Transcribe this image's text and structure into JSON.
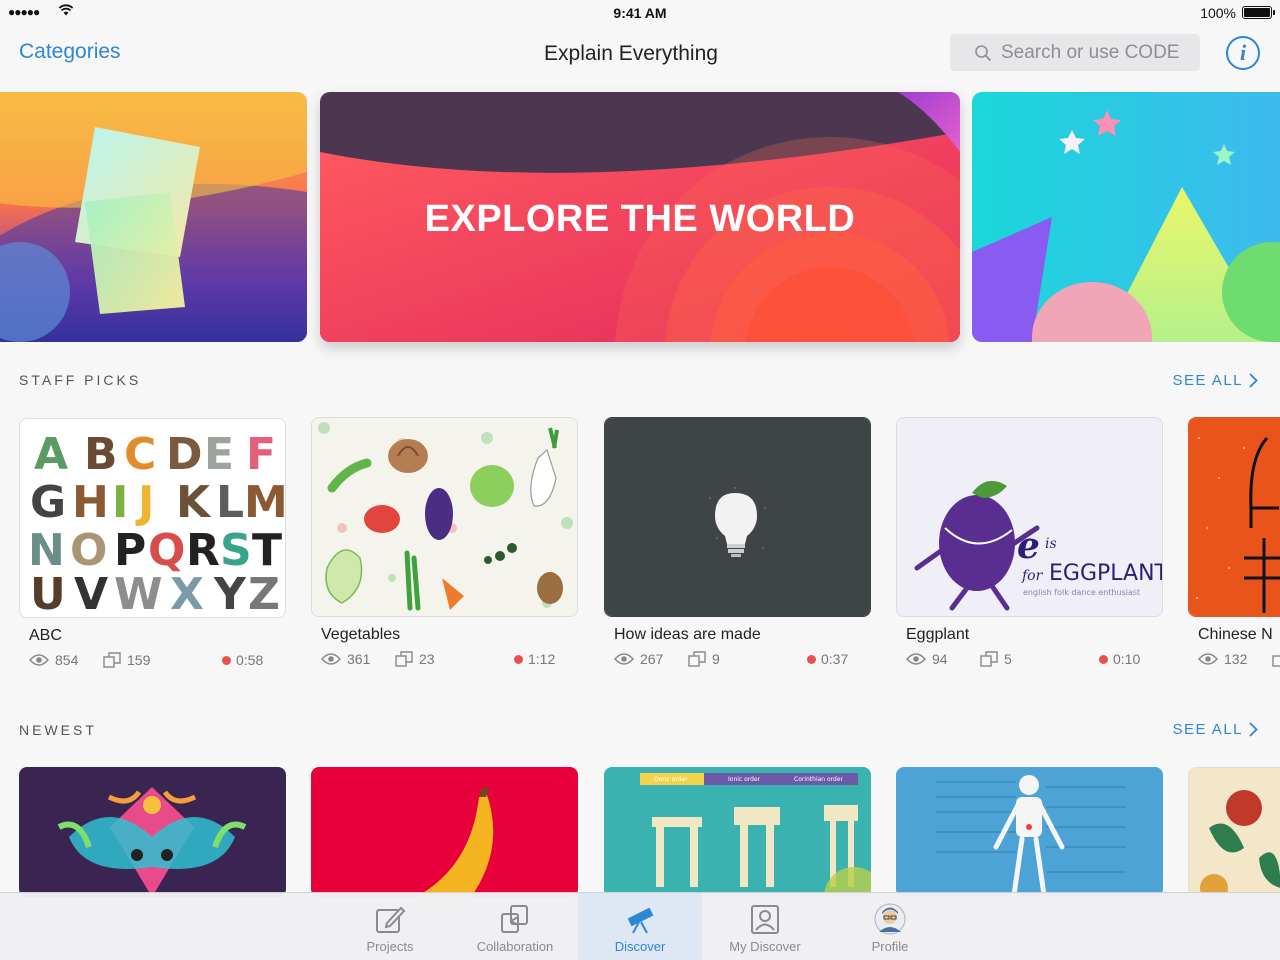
{
  "status": {
    "signal": "●●●●●",
    "time": "9:41 AM",
    "battery": "100%"
  },
  "nav": {
    "categories": "Categories",
    "title": "Explain Everything",
    "search_placeholder": "Search or use CODE",
    "info": "i"
  },
  "banner": {
    "label": "EXPLORE THE WORLD"
  },
  "staff_picks": {
    "title": "STAFF PICKS",
    "see_all": "SEE ALL",
    "cards": [
      {
        "name": "ABC",
        "views": "854",
        "copies": "159",
        "duration": "0:58"
      },
      {
        "name": "Vegetables",
        "views": "361",
        "copies": "23",
        "duration": "1:12"
      },
      {
        "name": "How ideas are made",
        "views": "267",
        "copies": "9",
        "duration": "0:37"
      },
      {
        "name": "Eggplant",
        "views": "94",
        "copies": "5",
        "duration": "0:10"
      },
      {
        "name": "Chinese N",
        "views": "132",
        "copies": "",
        "duration": ""
      }
    ]
  },
  "newest": {
    "title": "NEWEST",
    "see_all": "SEE ALL"
  },
  "tabbar": {
    "tabs": [
      {
        "label": "Projects",
        "icon": "edit-icon"
      },
      {
        "label": "Collaboration",
        "icon": "collaboration-icon"
      },
      {
        "label": "Discover",
        "icon": "telescope-icon",
        "active": true
      },
      {
        "label": "My Discover",
        "icon": "portrait-icon"
      },
      {
        "label": "Profile",
        "icon": "avatar"
      }
    ]
  },
  "colors": {
    "accent": "#2e86d6",
    "duration_dot": "#e8524d"
  }
}
